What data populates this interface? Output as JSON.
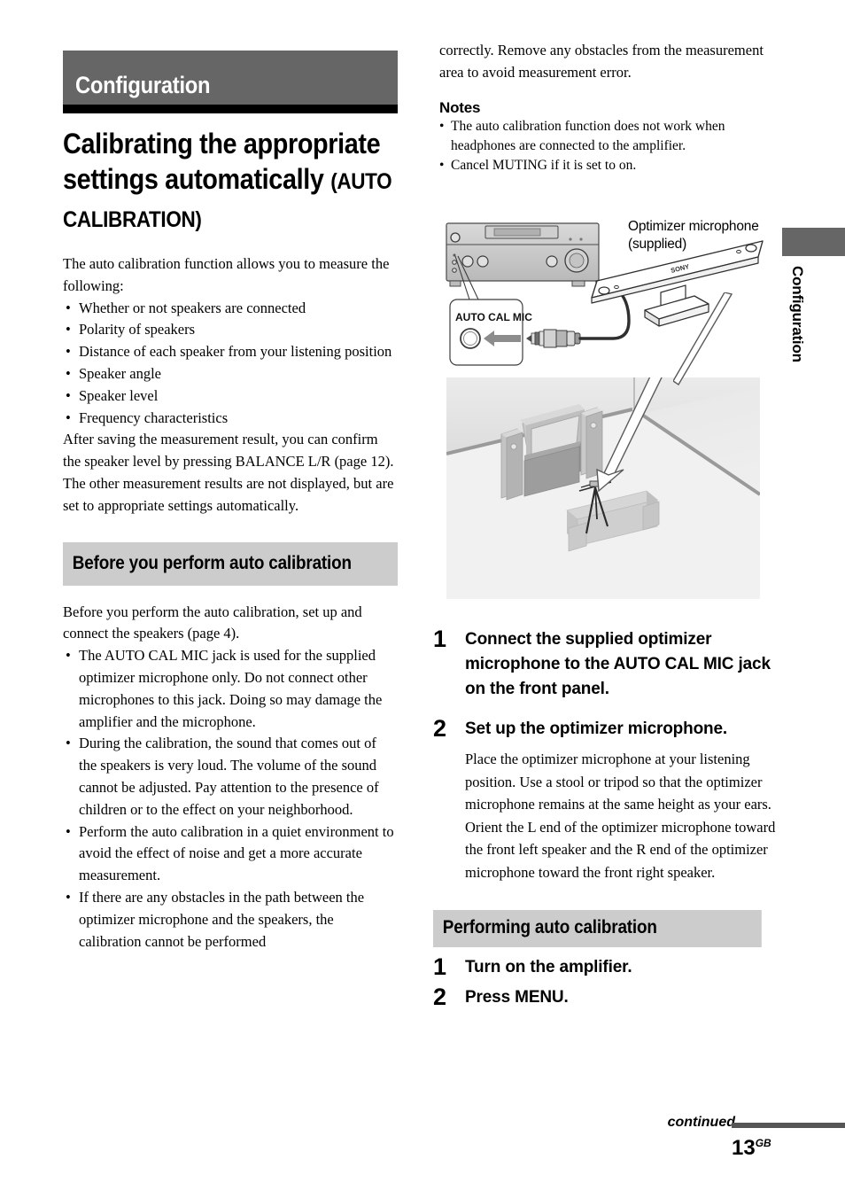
{
  "chapter": {
    "bar_title": "Configuration",
    "side_tab_label": "Configuration"
  },
  "title": {
    "main": "Calibrating the appropriate settings automatically ",
    "smallcaps": "(AUTO CALIBRATION)"
  },
  "left_column": {
    "intro": "The auto calibration function allows you to measure the following:",
    "measure_list": [
      "Whether or not speakers are connected",
      "Polarity of speakers",
      "Distance of each speaker from your listening position",
      "Speaker angle",
      "Speaker level",
      "Frequency characteristics"
    ],
    "after_paragraph": "After saving the measurement result, you can confirm the speaker level by pressing BALANCE L/R (page 12). The other measurement results are not displayed, but are set to appropriate settings automatically.",
    "section_heading": "Before you perform auto calibration",
    "before_intro": "Before you perform the auto calibration, set up and connect the speakers (page 4).",
    "before_bullets": [
      "The AUTO CAL MIC jack is used for the supplied optimizer microphone only. Do not connect other microphones to this jack. Doing so may damage the amplifier and the microphone.",
      "During the calibration, the sound that comes out of the speakers is very loud. The volume of the sound cannot be adjusted. Pay attention to the presence of children or to the effect on your neighborhood.",
      "Perform the auto calibration in a quiet environment to avoid the effect of noise and get a more accurate measurement.",
      "If there are any obstacles in the path between the optimizer microphone and the speakers, the calibration cannot be performed"
    ]
  },
  "right_column": {
    "continuation_paragraph": "correctly. Remove any obstacles from the measurement area to avoid measurement error.",
    "notes_heading": "Notes",
    "notes": [
      "The auto calibration function does not work when headphones are connected to the amplifier.",
      "Cancel MUTING if it is set to on."
    ],
    "figure_labels": {
      "mic_caption": "Optimizer microphone\n(supplied)",
      "jack_label": "AUTO CAL MIC",
      "brand": "SONY"
    },
    "steps": [
      {
        "number": "1",
        "text": "Connect the supplied optimizer microphone to the AUTO CAL MIC jack on the front panel.",
        "body": ""
      },
      {
        "number": "2",
        "text": "Set up the optimizer microphone.",
        "body": "Place the optimizer microphone at your listening position. Use a stool or tripod so that the optimizer microphone remains at the same height as your ears. Orient the L end of the optimizer microphone toward the front left speaker and the R end of the optimizer microphone toward the front right speaker."
      }
    ],
    "section_heading": "Performing auto calibration",
    "steps2": [
      {
        "number": "1",
        "text": "Turn on the amplifier."
      },
      {
        "number": "2",
        "text": "Press MENU."
      }
    ]
  },
  "footer": {
    "continued": "continued",
    "page_number": "13",
    "page_suffix": "GB"
  },
  "colors": {
    "chapter_bar": "#666666",
    "chapter_rule": "#000000",
    "section_heading_bg": "#cccccc",
    "text": "#000000"
  }
}
